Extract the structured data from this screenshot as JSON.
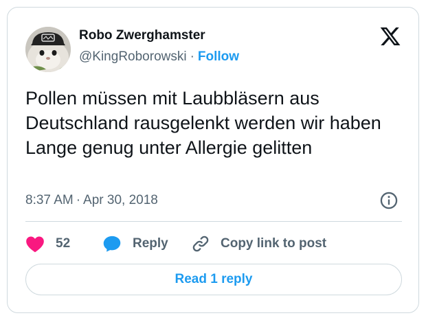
{
  "author": {
    "name": "Robo Zwerghamster",
    "handle": "@KingRoborowski",
    "separator": "·",
    "follow_label": "Follow"
  },
  "tweet": {
    "text": "Pollen müssen mit Laubbläsern aus Deutschland rausgelenkt werden wir haben Lange genug unter Allergie gelitten",
    "time": "8:37 AM",
    "separator": "·",
    "date": "Apr 30, 2018"
  },
  "actions": {
    "like_count": "52",
    "reply_label": "Reply",
    "copy_label": "Copy link to post"
  },
  "read_reply_label": "Read 1 reply",
  "icons": {
    "brand": "x-logo-icon",
    "info": "info-icon",
    "like": "heart-icon",
    "reply": "speech-bubble-icon",
    "copy": "link-icon"
  },
  "colors": {
    "like": "#f91880",
    "reply": "#1d9bf0",
    "link": "#1d9bf0",
    "muted": "#536471",
    "text": "#0f1419",
    "border": "#cfd9de"
  }
}
